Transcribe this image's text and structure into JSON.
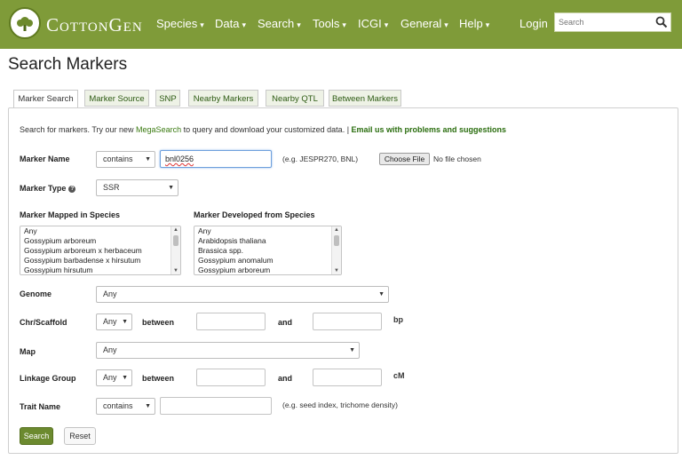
{
  "header": {
    "brand": "CottonGen",
    "nav": [
      "Species",
      "Data",
      "Search",
      "Tools",
      "ICGI",
      "General",
      "Help"
    ],
    "login": "Login",
    "search_placeholder": "Search"
  },
  "page_title": "Search Markers",
  "tabs": [
    "Marker Search",
    "Marker Source",
    "SNP",
    "Nearby Markers",
    "Nearby QTL",
    "Between Markers"
  ],
  "intro": {
    "text_before": "Search for markers. Try our new ",
    "link": "MegaSearch",
    "text_after": " to query and download your customized data. | ",
    "email": "Email us with problems and suggestions"
  },
  "form": {
    "marker_name": {
      "label": "Marker Name",
      "op": "contains",
      "value": "bnl0256",
      "hint": "(e.g. JESPR270, BNL)",
      "file_button": "Choose File",
      "file_status": "No file chosen"
    },
    "marker_type": {
      "label": "Marker Type",
      "value": "SSR"
    },
    "mapped_species": {
      "label": "Marker Mapped in Species",
      "options": [
        "Any",
        "Gossypium arboreum",
        "Gossypium arboreum x herbaceum",
        "Gossypium barbadense x hirsutum",
        "Gossypium hirsutum"
      ]
    },
    "developed_species": {
      "label": "Marker Developed from Species",
      "options": [
        "Any",
        "Arabidopsis thaliana",
        "Brassica spp.",
        "Gossypium anomalum",
        "Gossypium arboreum"
      ]
    },
    "genome": {
      "label": "Genome",
      "value": "Any"
    },
    "chr": {
      "label": "Chr/Scaffold",
      "value": "Any",
      "between": "between",
      "and": "and",
      "unit": "bp"
    },
    "map": {
      "label": "Map",
      "value": "Any"
    },
    "linkage": {
      "label": "Linkage Group",
      "value": "Any",
      "between": "between",
      "and": "and",
      "unit": "cM"
    },
    "trait": {
      "label": "Trait Name",
      "op": "contains",
      "hint": "(e.g. seed index, trichome density)"
    }
  },
  "buttons": {
    "search": "Search",
    "reset": "Reset"
  },
  "colors": {
    "header_green": "#7f9b39",
    "button_green": "#6c8a2f",
    "link_green": "#3a7a10"
  }
}
